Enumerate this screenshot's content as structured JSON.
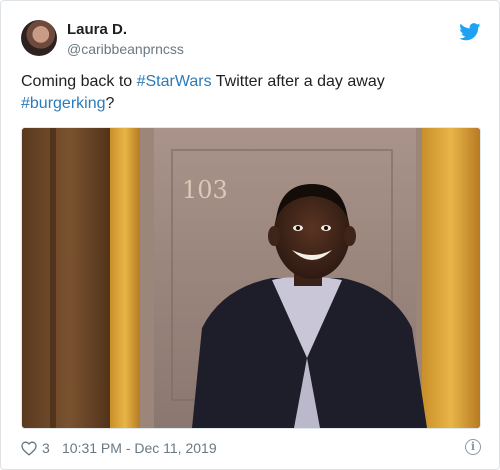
{
  "author": {
    "display_name": "Laura D.",
    "handle": "@caribbeanprncss"
  },
  "tweet": {
    "text_before": "Coming back to ",
    "hashtag_1": "#StarWars",
    "text_middle": " Twitter after a day away",
    "hashtag_2": "#burgerking",
    "text_after": "?"
  },
  "media": {
    "door_number": "103",
    "icon": "gif-image"
  },
  "footer": {
    "like_icon": "heart-icon",
    "like_count": "3",
    "timestamp": "10:31 PM - Dec 11, 2019",
    "info_icon": "info-icon"
  },
  "colors": {
    "hashtag": "#2b7bb9",
    "twitter_blue": "#1da1f2",
    "meta_text": "#697882"
  }
}
